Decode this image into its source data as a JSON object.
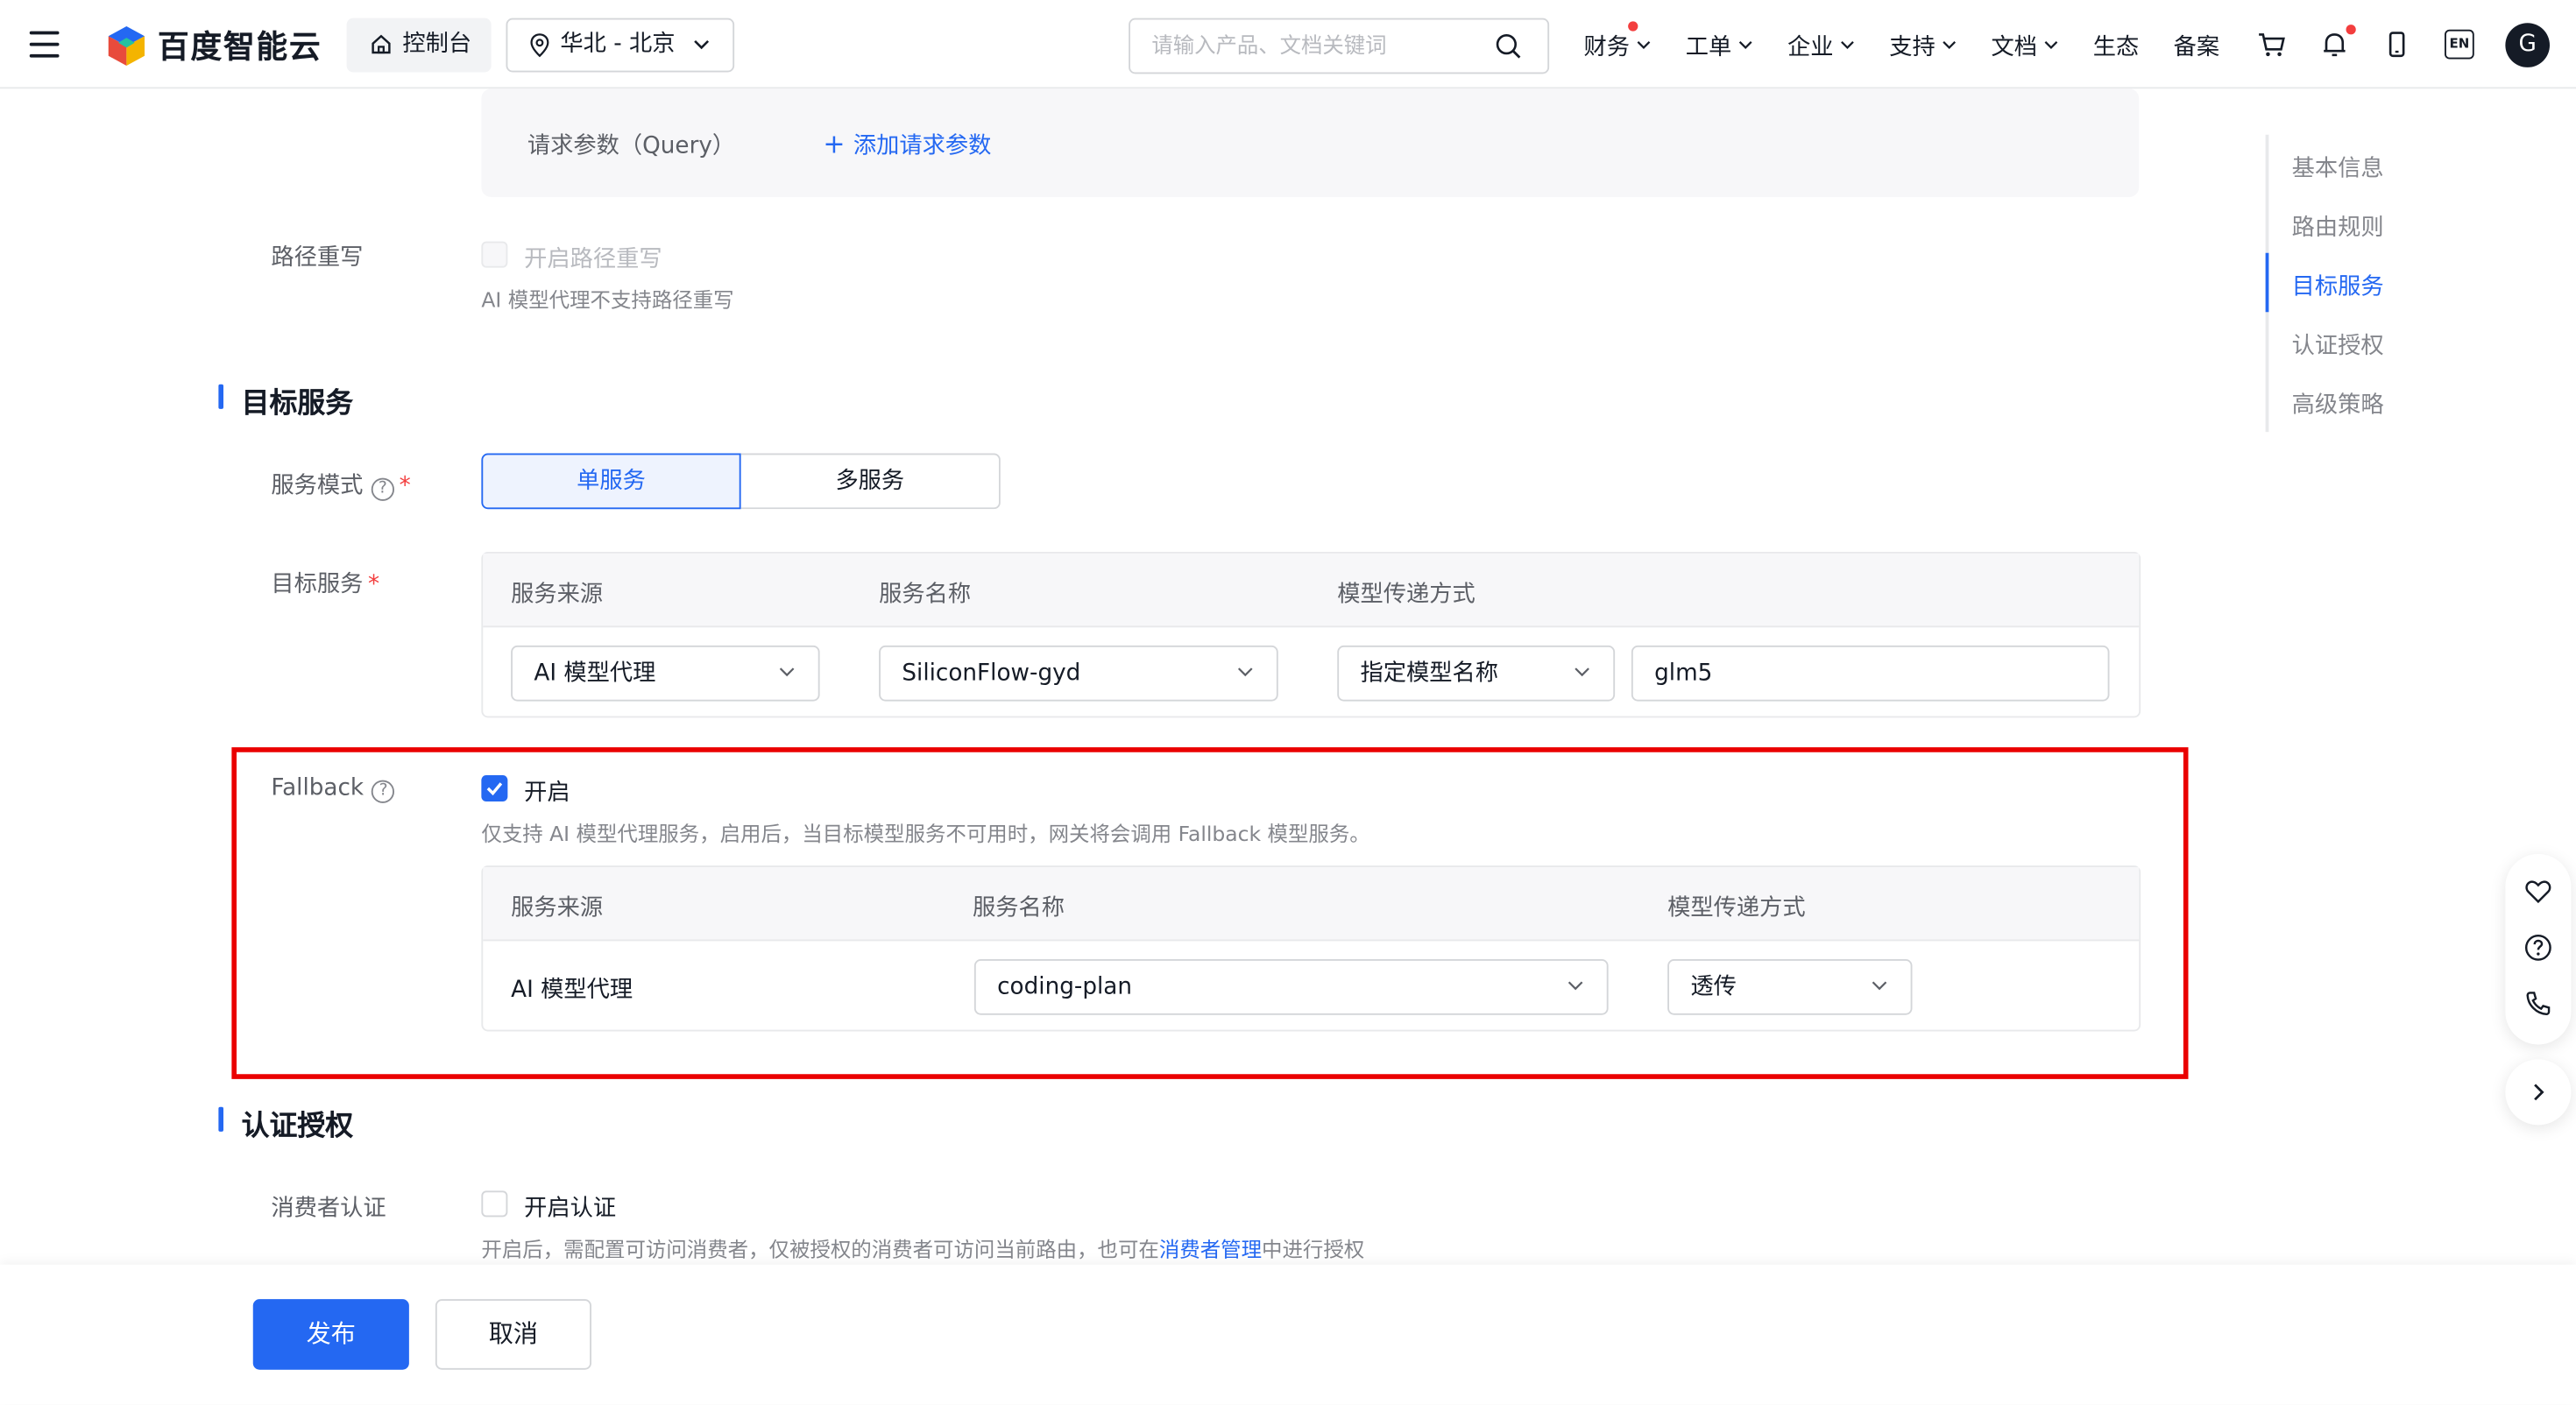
{
  "header": {
    "brand": "百度智能云",
    "console": "控制台",
    "region": "华北 - 北京",
    "search_placeholder": "请输入产品、文档关键词",
    "nav": [
      {
        "label": "财务",
        "has_menu": true,
        "dot": true
      },
      {
        "label": "工单",
        "has_menu": true
      },
      {
        "label": "企业",
        "has_menu": true
      },
      {
        "label": "支持",
        "has_menu": true
      },
      {
        "label": "文档",
        "has_menu": true
      },
      {
        "label": "生态"
      },
      {
        "label": "备案"
      }
    ],
    "avatar_letter": "G",
    "lang_badge": "EN",
    "icons": [
      "menu-icon",
      "home-icon",
      "location-icon",
      "search-icon",
      "cart-icon",
      "bell-icon",
      "mobile-icon",
      "language-icon"
    ]
  },
  "query_params": {
    "label": "请求参数（Query）",
    "add_link": "添加请求参数"
  },
  "path_rewrite": {
    "label": "路径重写",
    "checkbox_label": "开启路径重写",
    "hint": "AI 模型代理不支持路径重写"
  },
  "target_service": {
    "title": "目标服务",
    "mode_label": "服务模式",
    "mode_options": [
      "单服务",
      "多服务"
    ],
    "selected_mode": "单服务",
    "label": "目标服务",
    "columns": [
      "服务来源",
      "服务名称",
      "模型传递方式"
    ],
    "row": {
      "source": "AI 模型代理",
      "service_name": "SiliconFlow-gyd",
      "pass_mode": "指定模型名称",
      "model_name": "glm5"
    }
  },
  "fallback": {
    "label": "Fallback",
    "enabled": true,
    "checkbox_label": "开启",
    "hint": "仅支持 AI 模型代理服务，启用后，当目标模型服务不可用时，网关将会调用 Fallback 模型服务。",
    "columns": [
      "服务来源",
      "服务名称",
      "模型传递方式"
    ],
    "row": {
      "source": "AI 模型代理",
      "service_name": "coding-plan",
      "pass_mode": "透传"
    }
  },
  "auth": {
    "title": "认证授权",
    "consumer_label": "消费者认证",
    "checkbox_label": "开启认证",
    "hint_before": "开启后，需配置可访问消费者，仅被授权的消费者可访问当前路由，也可在",
    "hint_link": "消费者管理",
    "hint_after": "中进行授权"
  },
  "anchor_nav": {
    "items": [
      "基本信息",
      "路由规则",
      "目标服务",
      "认证授权",
      "高级策略"
    ],
    "active": "目标服务"
  },
  "footer": {
    "publish": "发布",
    "cancel": "取消"
  },
  "colors": {
    "accent": "#2468f2",
    "highlight_border": "#ea0000",
    "required": "#f33e3e"
  }
}
